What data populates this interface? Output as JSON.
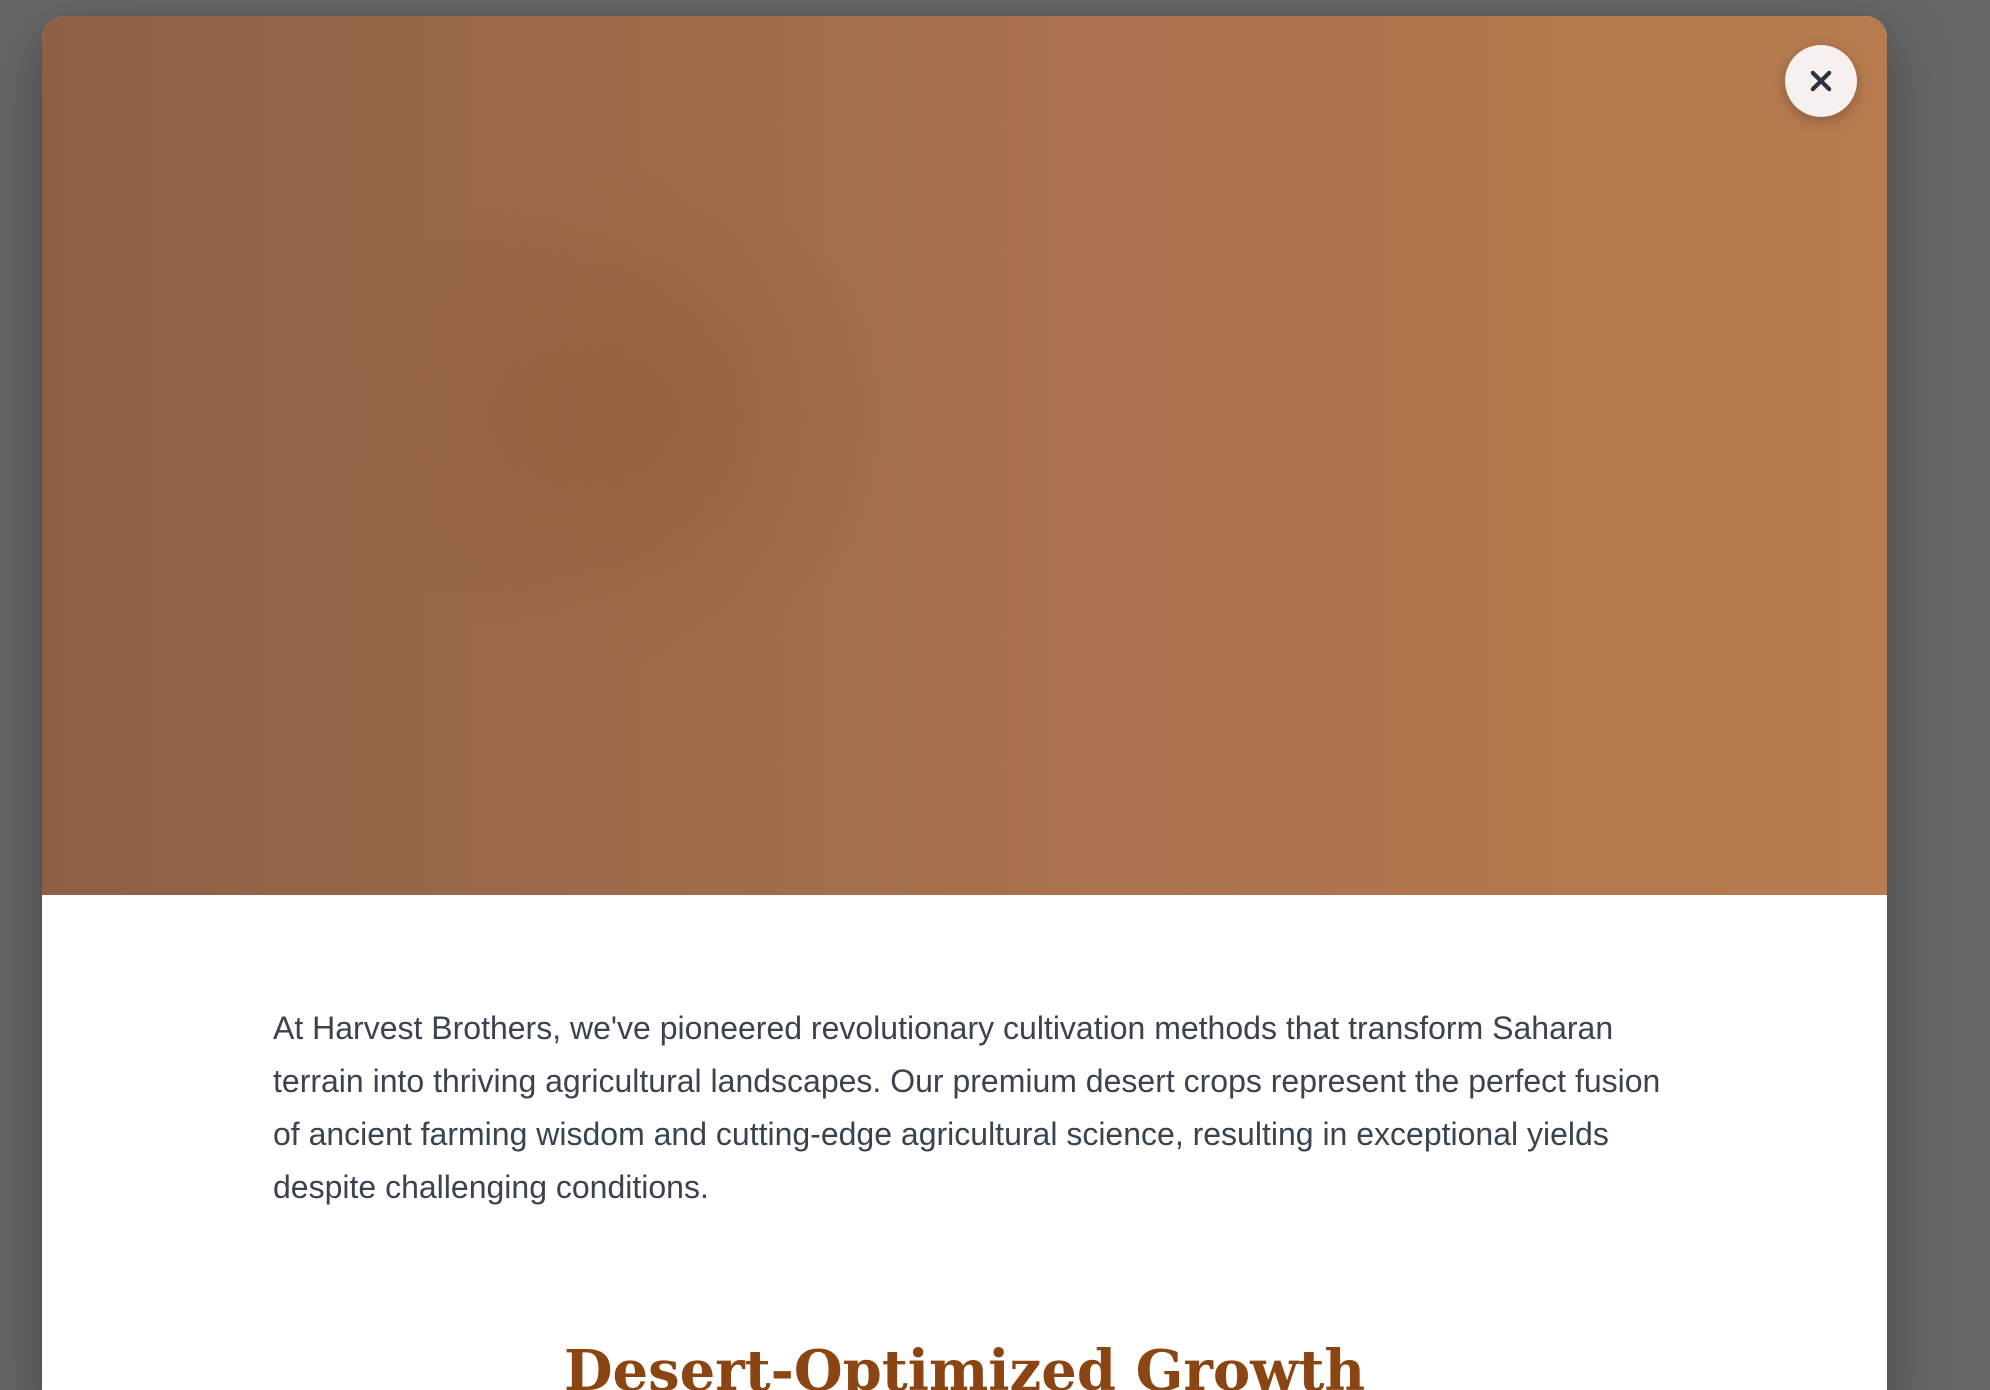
{
  "modal": {
    "close_icon": "close-icon",
    "intro_text": "At Harvest Brothers, we've pioneered revolutionary cultivation methods that transform Saharan terrain into thriving agricultural landscapes. Our premium desert crops represent the perfect fusion of ancient farming wisdom and cutting-edge agricultural science, resulting in exceptional yields despite challenging conditions.",
    "section_title": "Desert-Optimized Growth"
  },
  "colors": {
    "backdrop": "#676767",
    "hero_start": "#8d5f46",
    "hero_end": "#b87b4f",
    "title": "#8b4513",
    "body_text": "#3b4350"
  }
}
